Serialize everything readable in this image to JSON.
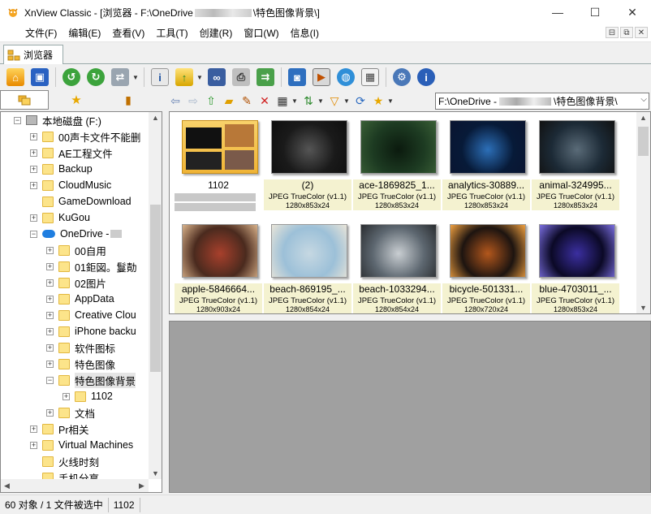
{
  "window": {
    "title_prefix": "XnView Classic - [浏览器 - F:\\OneDrive",
    "title_suffix": "\\特色图像背景\\]",
    "min": "—",
    "max": "☐",
    "close": "✕"
  },
  "menu": [
    "文件(F)",
    "编辑(E)",
    "查看(V)",
    "工具(T)",
    "创建(R)",
    "窗口(W)",
    "信息(I)"
  ],
  "mdi_buttons": [
    "⊟",
    "⧉",
    "✕"
  ],
  "tab": {
    "label": "浏览器"
  },
  "path": {
    "prefix": "F:\\OneDrive -",
    "suffix": "\\特色图像背景\\"
  },
  "tree": {
    "items": [
      {
        "label": "本地磁盘 (F:)",
        "level": 0,
        "type": "drive",
        "exp": "−"
      },
      {
        "label": "00声卡文件不能删",
        "level": 1,
        "type": "folder",
        "exp": "+"
      },
      {
        "label": "AE工程文件",
        "level": 1,
        "type": "folder",
        "exp": "+"
      },
      {
        "label": "Backup",
        "level": 1,
        "type": "folder",
        "exp": "+"
      },
      {
        "label": "CloudMusic",
        "level": 1,
        "type": "folder",
        "exp": "+"
      },
      {
        "label": "GameDownload",
        "level": 1,
        "type": "folder",
        "exp": ""
      },
      {
        "label": "KuGou",
        "level": 1,
        "type": "folder",
        "exp": "+"
      },
      {
        "label": "OneDrive -",
        "level": 1,
        "type": "cloud",
        "exp": "−"
      },
      {
        "label": "00自用",
        "level": 2,
        "type": "folder",
        "exp": "+"
      },
      {
        "label": "01鉅図。鬘勣",
        "level": 2,
        "type": "folder",
        "exp": "+"
      },
      {
        "label": "02图片",
        "level": 2,
        "type": "folder",
        "exp": "+"
      },
      {
        "label": "AppData",
        "level": 2,
        "type": "folder",
        "exp": "+"
      },
      {
        "label": "Creative Clou",
        "level": 2,
        "type": "folder",
        "exp": "+"
      },
      {
        "label": "iPhone backu",
        "level": 2,
        "type": "folder",
        "exp": "+"
      },
      {
        "label": "软件图标",
        "level": 2,
        "type": "folder",
        "exp": "+"
      },
      {
        "label": "特色图像",
        "level": 2,
        "type": "folder",
        "exp": "+"
      },
      {
        "label": "特色图像背景",
        "level": 2,
        "type": "folder",
        "exp": "−",
        "highlight": true
      },
      {
        "label": "1102",
        "level": 3,
        "type": "folder",
        "exp": "+"
      },
      {
        "label": "文档",
        "level": 2,
        "type": "folder",
        "exp": "+"
      },
      {
        "label": "Pr相关",
        "level": 1,
        "type": "folder",
        "exp": "+"
      },
      {
        "label": "Virtual Machines",
        "level": 1,
        "type": "folder",
        "exp": "+"
      },
      {
        "label": "火线时刻",
        "level": 1,
        "type": "folder",
        "exp": ""
      },
      {
        "label": "手机分享",
        "level": 1,
        "type": "folder",
        "exp": ""
      }
    ]
  },
  "thumbs": [
    {
      "name": "1102",
      "kind": "folder"
    },
    {
      "name": "(2)",
      "fmt": "JPEG TrueColor (v1.1)",
      "dim": "1280x853x24",
      "colors": [
        "#1a1a1a",
        "#555",
        "#0f0f0f"
      ]
    },
    {
      "name": "ace-1869825_1...",
      "fmt": "JPEG TrueColor (v1.1)",
      "dim": "1280x853x24",
      "colors": [
        "#1d3b22",
        "#0b1a0e",
        "#3a5f36"
      ]
    },
    {
      "name": "analytics-30889...",
      "fmt": "JPEG TrueColor (v1.1)",
      "dim": "1280x853x24",
      "colors": [
        "#071a38",
        "#2c6fb8",
        "#0a1430"
      ]
    },
    {
      "name": "animal-324995...",
      "fmt": "JPEG TrueColor (v1.1)",
      "dim": "1280x853x24",
      "colors": [
        "#1c2a36",
        "#5a6b78",
        "#111"
      ]
    },
    {
      "name": "apple-5846664...",
      "fmt": "JPEG TrueColor (v1.1)",
      "dim": "1280x903x24",
      "colors": [
        "#4a2a1e",
        "#a8402c",
        "#d9b28a"
      ]
    },
    {
      "name": "beach-869195_...",
      "fmt": "JPEG TrueColor (v1.1)",
      "dim": "1280x854x24",
      "colors": [
        "#9cc0d8",
        "#c6d8e2",
        "#e9e4d8"
      ]
    },
    {
      "name": "beach-1033294...",
      "fmt": "JPEG TrueColor (v1.1)",
      "dim": "1280x854x24",
      "colors": [
        "#5d6770",
        "#c9ced2",
        "#2a2d30"
      ]
    },
    {
      "name": "bicycle-501331...",
      "fmt": "JPEG TrueColor (v1.1)",
      "dim": "1280x720x24",
      "colors": [
        "#1d1410",
        "#b3571c",
        "#f0a040"
      ]
    },
    {
      "name": "blue-4703011_...",
      "fmt": "JPEG TrueColor (v1.1)",
      "dim": "1280x853x24",
      "colors": [
        "#0b0926",
        "#3b2fa0",
        "#7a6ee0"
      ]
    }
  ],
  "status": {
    "objects": "60 对象 / 1 文件被选中",
    "selected": "1102"
  }
}
